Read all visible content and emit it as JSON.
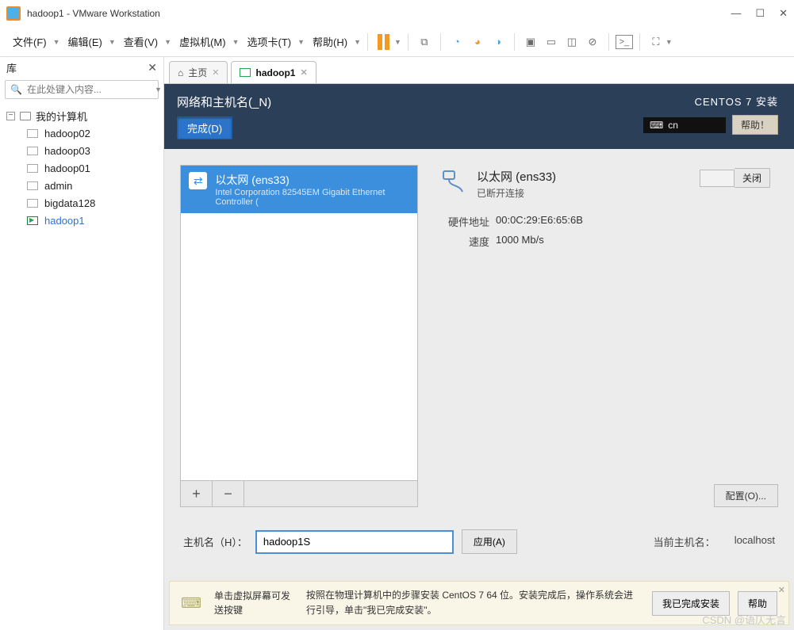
{
  "window": {
    "title": "hadoop1 - VMware Workstation"
  },
  "menu": {
    "file": "文件(F)",
    "edit": "编辑(E)",
    "view": "查看(V)",
    "vm": "虚拟机(M)",
    "tabs": "选项卡(T)",
    "help": "帮助(H)"
  },
  "sidebar": {
    "title": "库",
    "search_placeholder": "在此处键入内容...",
    "root": "我的计算机",
    "items": [
      {
        "label": "hadoop02"
      },
      {
        "label": "hadoop03"
      },
      {
        "label": "hadoop01"
      },
      {
        "label": "admin"
      },
      {
        "label": "bigdata128"
      },
      {
        "label": "hadoop1",
        "active": true
      }
    ]
  },
  "tabs": {
    "home": "主页",
    "vm": "hadoop1"
  },
  "installer": {
    "title": "网络和主机名(_N)",
    "done": "完成(D)",
    "product": "CENTOS 7 安装",
    "lang": "cn",
    "help": "帮助！",
    "list": {
      "name": "以太网 (ens33)",
      "sub": "Intel Corporation 82545EM Gigabit Ethernet Controller ("
    },
    "detail": {
      "name": "以太网 (ens33)",
      "status": "已断开连接",
      "hw_label": "硬件地址",
      "hw_value": "00:0C:29:E6:65:6B",
      "speed_label": "速度",
      "speed_value": "1000 Mb/s",
      "switch": "关闭",
      "config": "配置(O)..."
    },
    "host": {
      "label": "主机名（H）：",
      "value": "hadoop1S",
      "apply": "应用(A)",
      "current_label": "当前主机名：",
      "current_value": "localhost"
    }
  },
  "tip": {
    "col1": "单击虚拟屏幕可发送按键",
    "col2": "按照在物理计算机中的步骤安装 CentOS 7 64 位。安装完成后，操作系统会进行引导，单击\"我已完成安装\"。",
    "done": "我已完成安装",
    "help": "帮助"
  },
  "watermark": "CSDN @语仄无言"
}
